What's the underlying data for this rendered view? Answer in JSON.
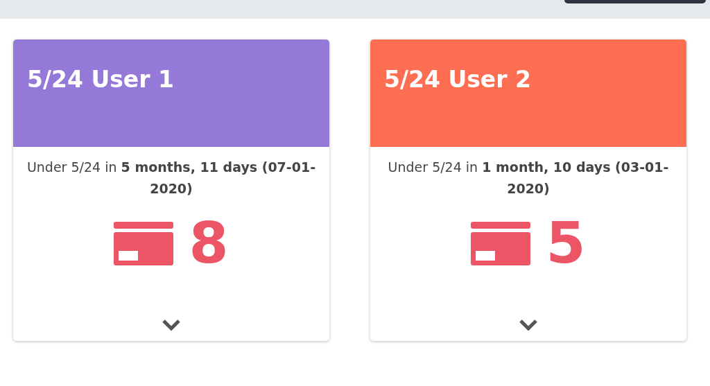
{
  "cards": [
    {
      "title": "5/24 User 1",
      "color": "#9579d9",
      "description": "Under 5/24 in **5 months, 11 days (07-01-2020)**",
      "count": "8"
    },
    {
      "title": "5/24 User 2",
      "color": "#fe6e52",
      "description": "Under 5/24 in **1 month, 10 days (03-01-2020)**",
      "count": "5"
    }
  ]
}
